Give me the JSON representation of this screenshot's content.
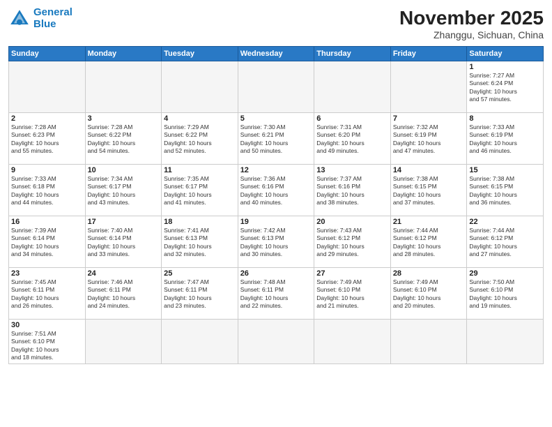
{
  "header": {
    "logo_general": "General",
    "logo_blue": "Blue",
    "month": "November 2025",
    "location": "Zhanggu, Sichuan, China"
  },
  "weekdays": [
    "Sunday",
    "Monday",
    "Tuesday",
    "Wednesday",
    "Thursday",
    "Friday",
    "Saturday"
  ],
  "weeks": [
    [
      {
        "day": "",
        "info": ""
      },
      {
        "day": "",
        "info": ""
      },
      {
        "day": "",
        "info": ""
      },
      {
        "day": "",
        "info": ""
      },
      {
        "day": "",
        "info": ""
      },
      {
        "day": "",
        "info": ""
      },
      {
        "day": "1",
        "info": "Sunrise: 7:27 AM\nSunset: 6:24 PM\nDaylight: 10 hours\nand 57 minutes."
      }
    ],
    [
      {
        "day": "2",
        "info": "Sunrise: 7:28 AM\nSunset: 6:23 PM\nDaylight: 10 hours\nand 55 minutes."
      },
      {
        "day": "3",
        "info": "Sunrise: 7:28 AM\nSunset: 6:22 PM\nDaylight: 10 hours\nand 54 minutes."
      },
      {
        "day": "4",
        "info": "Sunrise: 7:29 AM\nSunset: 6:22 PM\nDaylight: 10 hours\nand 52 minutes."
      },
      {
        "day": "5",
        "info": "Sunrise: 7:30 AM\nSunset: 6:21 PM\nDaylight: 10 hours\nand 50 minutes."
      },
      {
        "day": "6",
        "info": "Sunrise: 7:31 AM\nSunset: 6:20 PM\nDaylight: 10 hours\nand 49 minutes."
      },
      {
        "day": "7",
        "info": "Sunrise: 7:32 AM\nSunset: 6:19 PM\nDaylight: 10 hours\nand 47 minutes."
      },
      {
        "day": "8",
        "info": "Sunrise: 7:33 AM\nSunset: 6:19 PM\nDaylight: 10 hours\nand 46 minutes."
      }
    ],
    [
      {
        "day": "9",
        "info": "Sunrise: 7:33 AM\nSunset: 6:18 PM\nDaylight: 10 hours\nand 44 minutes."
      },
      {
        "day": "10",
        "info": "Sunrise: 7:34 AM\nSunset: 6:17 PM\nDaylight: 10 hours\nand 43 minutes."
      },
      {
        "day": "11",
        "info": "Sunrise: 7:35 AM\nSunset: 6:17 PM\nDaylight: 10 hours\nand 41 minutes."
      },
      {
        "day": "12",
        "info": "Sunrise: 7:36 AM\nSunset: 6:16 PM\nDaylight: 10 hours\nand 40 minutes."
      },
      {
        "day": "13",
        "info": "Sunrise: 7:37 AM\nSunset: 6:16 PM\nDaylight: 10 hours\nand 38 minutes."
      },
      {
        "day": "14",
        "info": "Sunrise: 7:38 AM\nSunset: 6:15 PM\nDaylight: 10 hours\nand 37 minutes."
      },
      {
        "day": "15",
        "info": "Sunrise: 7:38 AM\nSunset: 6:15 PM\nDaylight: 10 hours\nand 36 minutes."
      }
    ],
    [
      {
        "day": "16",
        "info": "Sunrise: 7:39 AM\nSunset: 6:14 PM\nDaylight: 10 hours\nand 34 minutes."
      },
      {
        "day": "17",
        "info": "Sunrise: 7:40 AM\nSunset: 6:14 PM\nDaylight: 10 hours\nand 33 minutes."
      },
      {
        "day": "18",
        "info": "Sunrise: 7:41 AM\nSunset: 6:13 PM\nDaylight: 10 hours\nand 32 minutes."
      },
      {
        "day": "19",
        "info": "Sunrise: 7:42 AM\nSunset: 6:13 PM\nDaylight: 10 hours\nand 30 minutes."
      },
      {
        "day": "20",
        "info": "Sunrise: 7:43 AM\nSunset: 6:12 PM\nDaylight: 10 hours\nand 29 minutes."
      },
      {
        "day": "21",
        "info": "Sunrise: 7:44 AM\nSunset: 6:12 PM\nDaylight: 10 hours\nand 28 minutes."
      },
      {
        "day": "22",
        "info": "Sunrise: 7:44 AM\nSunset: 6:12 PM\nDaylight: 10 hours\nand 27 minutes."
      }
    ],
    [
      {
        "day": "23",
        "info": "Sunrise: 7:45 AM\nSunset: 6:11 PM\nDaylight: 10 hours\nand 26 minutes."
      },
      {
        "day": "24",
        "info": "Sunrise: 7:46 AM\nSunset: 6:11 PM\nDaylight: 10 hours\nand 24 minutes."
      },
      {
        "day": "25",
        "info": "Sunrise: 7:47 AM\nSunset: 6:11 PM\nDaylight: 10 hours\nand 23 minutes."
      },
      {
        "day": "26",
        "info": "Sunrise: 7:48 AM\nSunset: 6:11 PM\nDaylight: 10 hours\nand 22 minutes."
      },
      {
        "day": "27",
        "info": "Sunrise: 7:49 AM\nSunset: 6:10 PM\nDaylight: 10 hours\nand 21 minutes."
      },
      {
        "day": "28",
        "info": "Sunrise: 7:49 AM\nSunset: 6:10 PM\nDaylight: 10 hours\nand 20 minutes."
      },
      {
        "day": "29",
        "info": "Sunrise: 7:50 AM\nSunset: 6:10 PM\nDaylight: 10 hours\nand 19 minutes."
      }
    ],
    [
      {
        "day": "30",
        "info": "Sunrise: 7:51 AM\nSunset: 6:10 PM\nDaylight: 10 hours\nand 18 minutes."
      },
      {
        "day": "",
        "info": ""
      },
      {
        "day": "",
        "info": ""
      },
      {
        "day": "",
        "info": ""
      },
      {
        "day": "",
        "info": ""
      },
      {
        "day": "",
        "info": ""
      },
      {
        "day": "",
        "info": ""
      }
    ]
  ]
}
